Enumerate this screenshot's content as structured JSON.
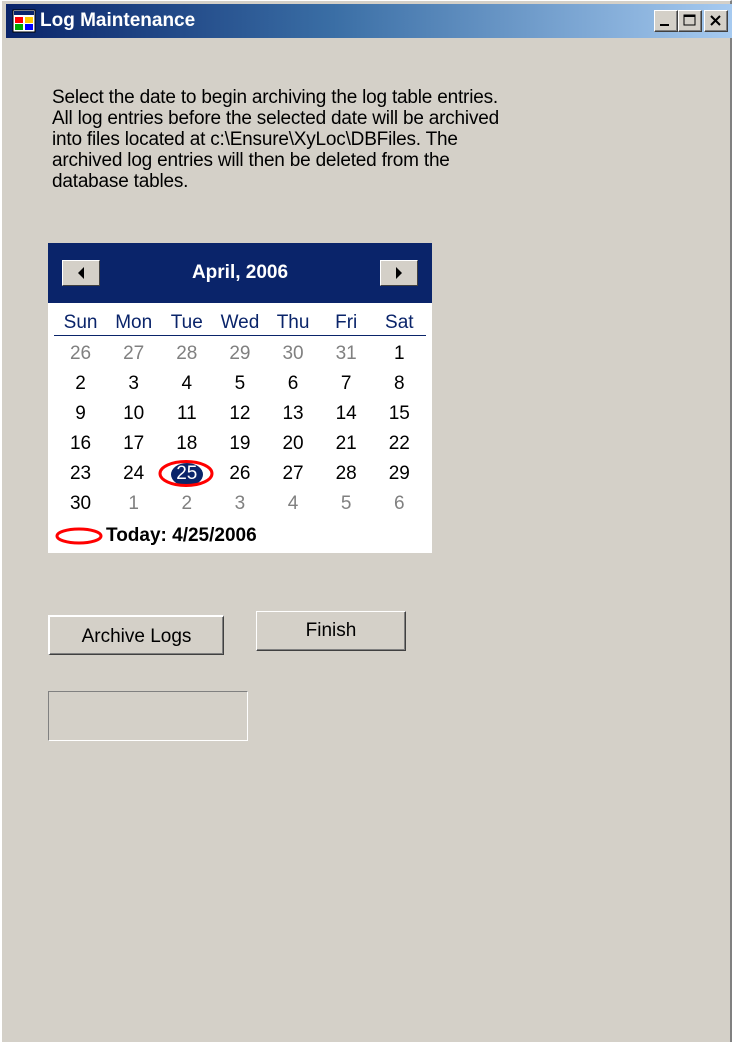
{
  "window": {
    "title": "Log Maintenance",
    "buttons": {
      "minimize": "minimize-icon",
      "maximize": "maximize-icon",
      "close": "close-icon"
    }
  },
  "instructions": "Select the date to begin archiving the log table entries.\nAll log entries before the selected date will be archived\ninto files located at c:\\Ensure\\XyLoc\\DBFiles.  The\narchived log entries will then be deleted from the\ndatabase tables.",
  "calendar": {
    "month_title": "April, 2006",
    "prev_icon": "left-arrow-icon",
    "next_icon": "right-arrow-icon",
    "days_of_week": [
      "Sun",
      "Mon",
      "Tue",
      "Wed",
      "Thu",
      "Fri",
      "Sat"
    ],
    "weeks": [
      [
        {
          "d": "26",
          "o": true
        },
        {
          "d": "27",
          "o": true
        },
        {
          "d": "28",
          "o": true
        },
        {
          "d": "29",
          "o": true
        },
        {
          "d": "30",
          "o": true
        },
        {
          "d": "31",
          "o": true
        },
        {
          "d": "1"
        }
      ],
      [
        {
          "d": "2"
        },
        {
          "d": "3"
        },
        {
          "d": "4"
        },
        {
          "d": "5"
        },
        {
          "d": "6"
        },
        {
          "d": "7"
        },
        {
          "d": "8"
        }
      ],
      [
        {
          "d": "9"
        },
        {
          "d": "10"
        },
        {
          "d": "11"
        },
        {
          "d": "12"
        },
        {
          "d": "13"
        },
        {
          "d": "14"
        },
        {
          "d": "15"
        }
      ],
      [
        {
          "d": "16"
        },
        {
          "d": "17"
        },
        {
          "d": "18"
        },
        {
          "d": "19"
        },
        {
          "d": "20"
        },
        {
          "d": "21"
        },
        {
          "d": "22"
        }
      ],
      [
        {
          "d": "23"
        },
        {
          "d": "24"
        },
        {
          "d": "25",
          "s": true
        },
        {
          "d": "26"
        },
        {
          "d": "27"
        },
        {
          "d": "28"
        },
        {
          "d": "29"
        }
      ],
      [
        {
          "d": "30"
        },
        {
          "d": "1",
          "o": true
        },
        {
          "d": "2",
          "o": true
        },
        {
          "d": "3",
          "o": true
        },
        {
          "d": "4",
          "o": true
        },
        {
          "d": "5",
          "o": true
        },
        {
          "d": "6",
          "o": true
        }
      ]
    ],
    "selected_date": "25",
    "today_label": "Today: 4/25/2006"
  },
  "buttons": {
    "archive_label": "Archive Logs",
    "finish_label": "Finish"
  },
  "status_box": {
    "value": ""
  },
  "colors": {
    "face": "#d4d0c8",
    "title_start": "#0a246a",
    "title_end": "#a6caf0",
    "calendar_header": "#0a246a",
    "today_ring": "#ff0000"
  }
}
